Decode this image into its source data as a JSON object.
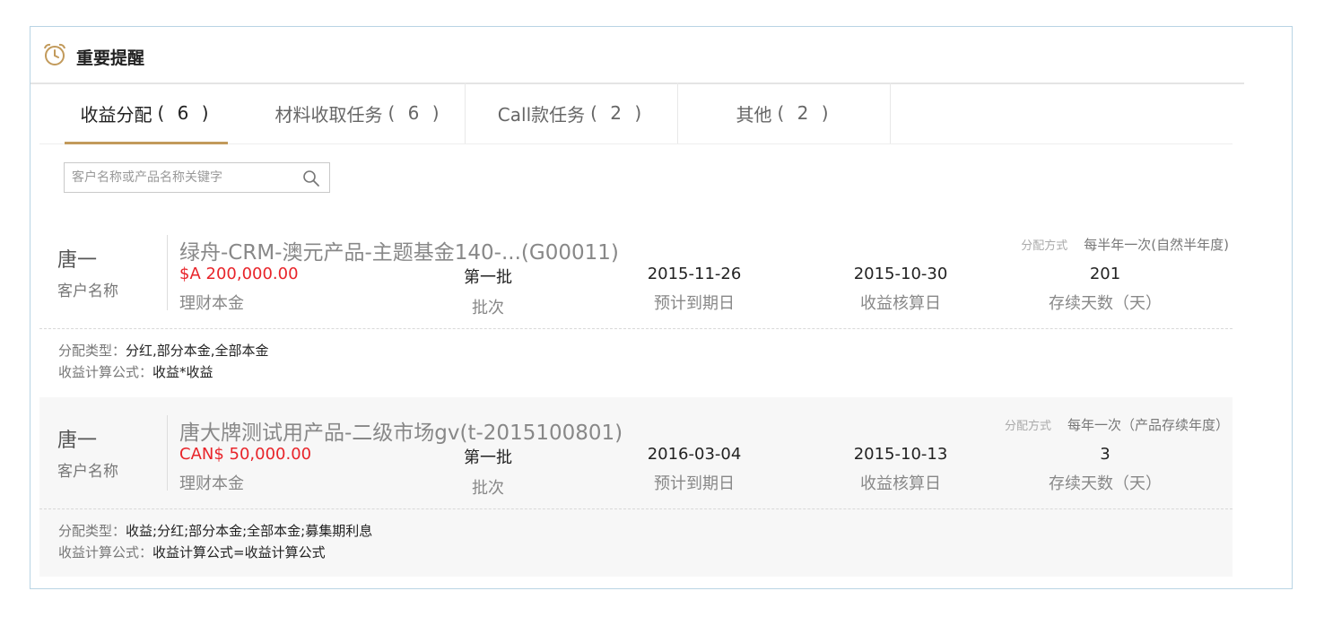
{
  "panel": {
    "title": "重要提醒",
    "icon": "alarm-clock-icon"
  },
  "tabs": [
    {
      "label": "收益分配",
      "count": "( 6 )",
      "active": true
    },
    {
      "label": "材料收取任务",
      "count": "( 6 )",
      "active": false
    },
    {
      "label": "Call款任务",
      "count": "( 2 )",
      "active": false
    },
    {
      "label": "其他",
      "count": "( 2 )",
      "active": false
    }
  ],
  "search": {
    "placeholder": "客户名称或产品名称关键字",
    "value": ""
  },
  "cards": [
    {
      "client_name": "唐一",
      "client_label": "客户名称",
      "product": "绿舟-CRM-澳元产品-主题基金140-...(G00011)",
      "dist_label": "分配方式",
      "dist_value": "每半年一次(自然半年度)",
      "amount": "$A 200,000.00",
      "amount_label": "理财本金",
      "batch": "第一批",
      "batch_label": "批次",
      "due_date": "2015-11-26",
      "due_label": "预计到期日",
      "settle_date": "2015-10-30",
      "settle_label": "收益核算日",
      "days": "201",
      "days_label": "存续天数（天）",
      "type_label": "分配类型：",
      "type_value": "分红,部分本金,全部本金",
      "formula_label": "收益计算公式：",
      "formula_value": "收益*收益"
    },
    {
      "client_name": "唐一",
      "client_label": "客户名称",
      "product": "唐大牌测试用产品-二级市场gv(t-2015100801)",
      "dist_label": "分配方式",
      "dist_value": "每年一次（产品存续年度）",
      "amount": "CAN$ 50,000.00",
      "amount_label": "理财本金",
      "batch": "第一批",
      "batch_label": "批次",
      "due_date": "2016-03-04",
      "due_label": "预计到期日",
      "settle_date": "2015-10-13",
      "settle_label": "收益核算日",
      "days": "3",
      "days_label": "存续天数（天）",
      "type_label": "分配类型：",
      "type_value": "收益;分红;部分本金;全部本金;募集期利息",
      "formula_label": "收益计算公式：",
      "formula_value": "收益计算公式=收益计算公式"
    }
  ],
  "colors": {
    "accent": "#c29a5b",
    "amount": "#e8242a",
    "panel_border": "#b9d4e4"
  }
}
